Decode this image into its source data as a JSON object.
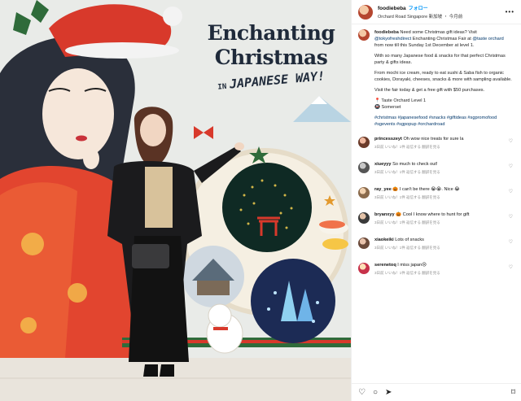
{
  "poster": {
    "line1": "Enchanting",
    "line2": "Christmas",
    "in_word": "IN",
    "line3": "JAPANESE WAY!"
  },
  "post": {
    "username": "foodiebeba",
    "follow_label": "フォロー",
    "location": "Orchard Road Singapore 新加坡 ・ 今月前",
    "more_icon": "more-icon",
    "caption": {
      "p1_user": "foodiebeba",
      "p1a": " Need some Christmas gift ideas? Visit ",
      "p1_link1": "@tokyofreshdirect",
      "p1b": " Enchanting Christmas Fair at ",
      "p1_link2": "@taste orchard",
      "p1c": " from now till this Sunday 1st December at level 1.",
      "p2": "With so many Japanese food & snacks for that perfect Christmas party & gifts ideas.",
      "p3": "From mochi ice cream, ready to eat sushi & Saba fish to organic cookies, Dorayaki, cheeses, snacks & more with sampling available.",
      "p4": "Visit the fair today & get a free gift with $50 purchases.",
      "p5": "📍 Taste Orchard Level 1",
      "p6": "🚇 Somerset",
      "tags": "#christmas #japanesefood #snacks #giftideas #sgpromofood #sgevents #sgpopup #orchardroad"
    }
  },
  "comments": [
    {
      "user": "princesszeyt",
      "text": "Oh wow nice treats for sure la",
      "meta": "3日前  いいね！1件  返信する  翻訳を見る"
    },
    {
      "user": "xiueyyy",
      "text": "So much to check out!",
      "meta": "3日前  いいね！1件  返信する  翻訳を見る"
    },
    {
      "user": "ray_yee",
      "text": "🎃 I can't be there 😭😭. Nice 😂",
      "meta": "3日前  いいね！1件  返信する  翻訳を見る"
    },
    {
      "user": "bryanxyy",
      "text": "🎃 Cool I know where to hunt for gift",
      "meta": "3日前  いいね！1件  返信する  翻訳を見る"
    },
    {
      "user": "xiaokeiki",
      "text": "Lots of snacks",
      "meta": "3日前  いいね！1件  返信する  翻訳を見る"
    },
    {
      "user": "serenetoq",
      "text": "I miss japan😢",
      "meta": "3日前  いいね！1件  返信する  翻訳を見る"
    }
  ],
  "actions": {
    "like": "♡",
    "comment": "○",
    "share": "➤",
    "save": "⌑"
  },
  "colors": {
    "link": "#00376b",
    "follow": "#0095f6",
    "poster_red": "#d8392b",
    "poster_navy": "#1f2a3a"
  }
}
